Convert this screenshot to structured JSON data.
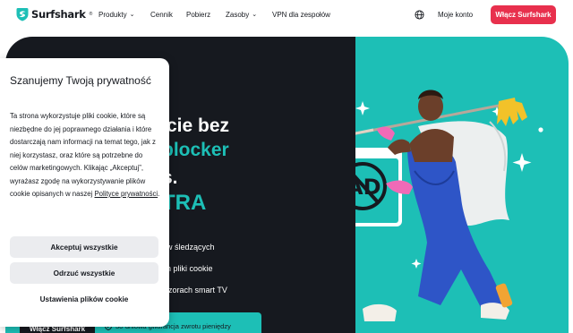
{
  "header": {
    "brand": "Surfshark",
    "brand_mark": "®",
    "menu": [
      {
        "label": "Produkty",
        "has_dropdown": true,
        "icon": "chevron-down-icon"
      },
      {
        "label": "Cennik",
        "has_dropdown": false
      },
      {
        "label": "Pobierz",
        "has_dropdown": false
      },
      {
        "label": "Zasoby",
        "has_dropdown": true,
        "icon": "chevron-down-icon"
      },
      {
        "label": "VPN dla zespołów",
        "has_dropdown": false
      }
    ],
    "language_icon": "globe-icon",
    "account_label": "Moje konto",
    "cta_label": "Włącz Surfshark"
  },
  "hero": {
    "headline": [
      "cie bez",
      "blocker",
      "s.",
      "TRA"
    ],
    "bullets": [
      "w śledzących",
      "n pliki cookie",
      "izorach smart TV"
    ],
    "cta_label": "Włącz Surfshark",
    "guarantee_icon": "shield-check-icon",
    "guarantee_text": "30-dniowa gwarancja zwrotu pieniędzy",
    "ad_badge_text": "AD"
  },
  "cookie_banner": {
    "title": "Szanujemy Twoją prywatność",
    "body": "Ta strona wykorzystuje pliki cookie, które są niezbędne do jej poprawnego działania i które dostarczają nam informacji na temat tego, jak z niej korzystasz, oraz które są potrzebne do celów marketingowych. Klikając „Akceptuj”, wyrażasz zgodę na wykorzystywanie plików cookie opisanych w naszej ",
    "policy_link": "Polityce prywatności",
    "policy_suffix": ".",
    "accept_label": "Akceptuj wszystkie",
    "reject_label": "Odrzuć wszystkie",
    "settings_label": "Ustawienia plików cookie"
  },
  "colors": {
    "brand_red": "#e8304d",
    "dark": "#16191f",
    "teal": "#1dbfb6",
    "button_gray": "#ebecef"
  }
}
